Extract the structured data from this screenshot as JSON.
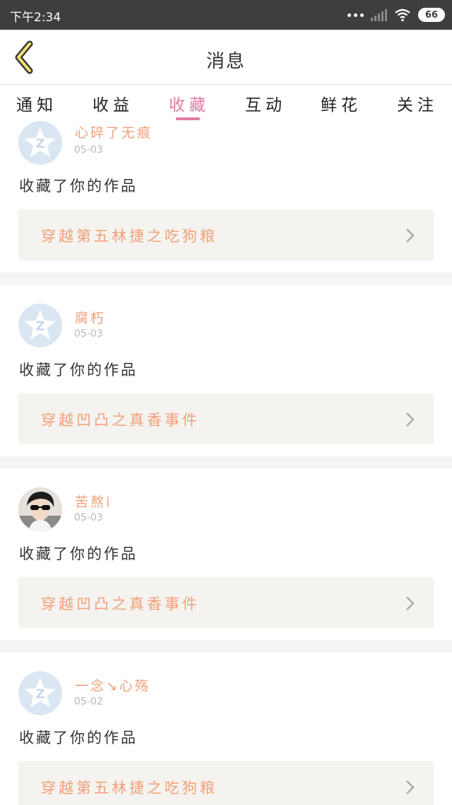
{
  "status_bar": {
    "time": "下午2:34",
    "battery": "66"
  },
  "header": {
    "title": "消息"
  },
  "tabs": [
    {
      "label": "通知",
      "active": false
    },
    {
      "label": "收益",
      "active": false
    },
    {
      "label": "收藏",
      "active": true
    },
    {
      "label": "互动",
      "active": false
    },
    {
      "label": "鲜花",
      "active": false
    },
    {
      "label": "关注",
      "active": false
    }
  ],
  "colors": {
    "accent": "#e27aa4",
    "name": "#f0a07a",
    "card_bg": "#f5f3ef"
  },
  "items": [
    {
      "user": "心碎了无痕",
      "date": "05-03",
      "action": "收藏了你的作品",
      "work": "穿越第五林捷之吃狗粮",
      "avatar": "default-qq-avatar"
    },
    {
      "user": "腐朽",
      "date": "05-03",
      "action": "收藏了你的作品",
      "work": "穿越凹凸之真香事件",
      "avatar": "default-qq-avatar"
    },
    {
      "user": "苦熬i",
      "date": "05-03",
      "action": "收藏了你的作品",
      "work": "穿越凹凸之真香事件",
      "avatar": "photo-avatar"
    },
    {
      "user": "一念↘心殇",
      "date": "05-02",
      "action": "收藏了你的作品",
      "work": "穿越第五林捷之吃狗粮",
      "avatar": "default-qq-avatar"
    }
  ]
}
